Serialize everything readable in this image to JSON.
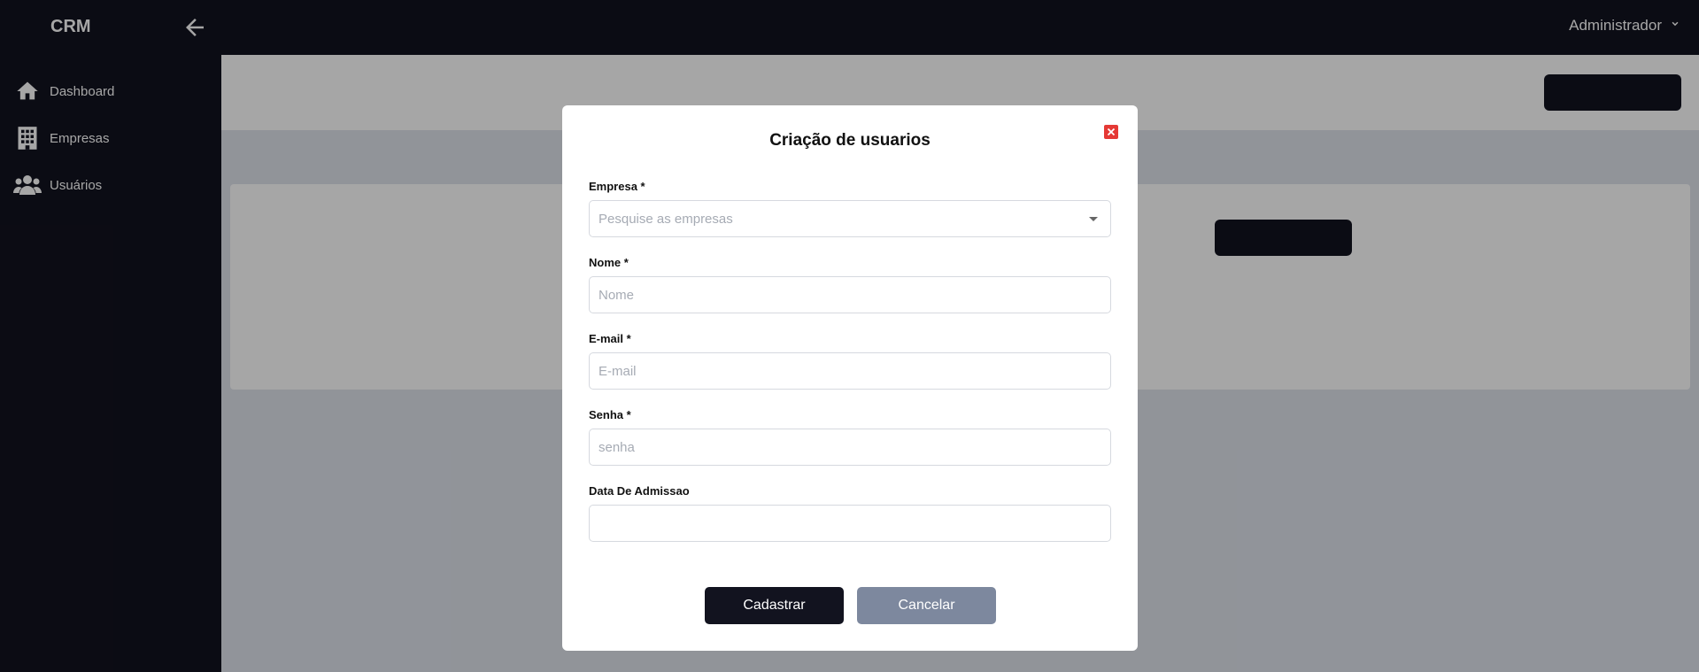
{
  "app": {
    "brand": "CRM",
    "user_menu_label": "Administrador"
  },
  "sidebar": {
    "items": [
      {
        "label": "Dashboard",
        "icon": "home-icon"
      },
      {
        "label": "Empresas",
        "icon": "building-icon"
      },
      {
        "label": "Usuários",
        "icon": "users-icon"
      }
    ]
  },
  "modal": {
    "title": "Criação de usuarios",
    "fields": [
      {
        "label": "Empresa *",
        "placeholder": "Pesquise as empresas",
        "type": "select"
      },
      {
        "label": "Nome *",
        "placeholder": "Nome",
        "type": "text"
      },
      {
        "label": "E-mail *",
        "placeholder": "E-mail",
        "type": "email"
      },
      {
        "label": "Senha *",
        "placeholder": "senha",
        "type": "password"
      },
      {
        "label": "Data De Admissao",
        "placeholder": "",
        "type": "date"
      }
    ],
    "submit_label": "Cadastrar",
    "cancel_label": "Cancelar"
  },
  "colors": {
    "dark": "#12131f",
    "close": "#e53935",
    "cancel": "#7d889e"
  }
}
